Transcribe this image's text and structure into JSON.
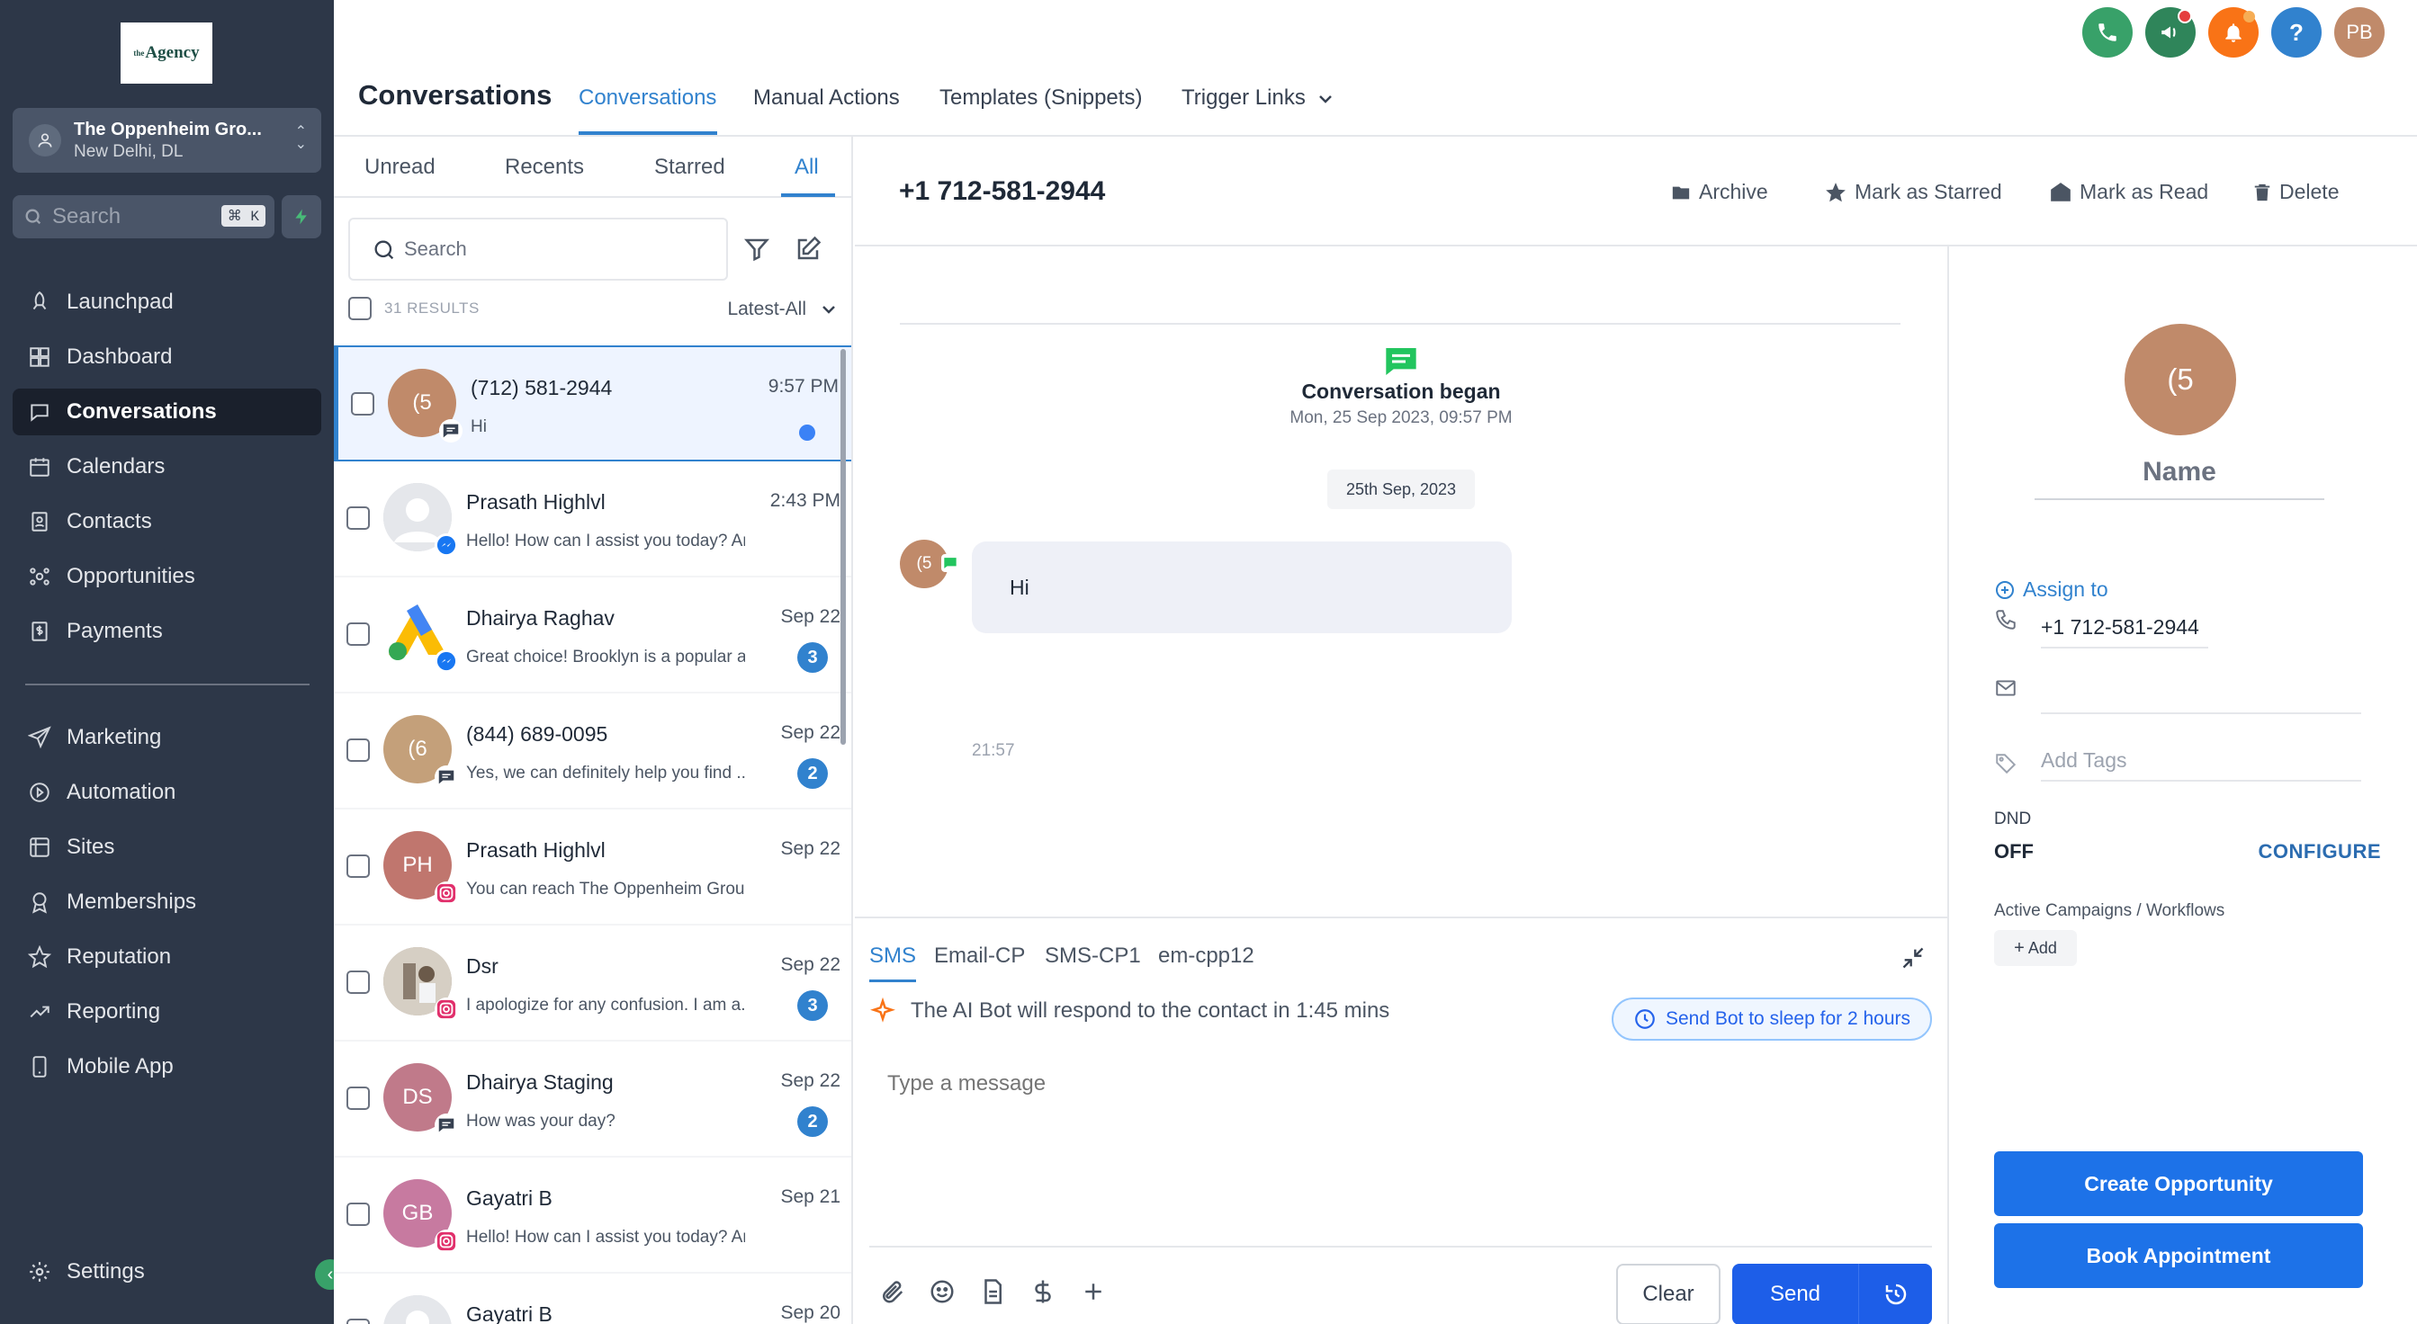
{
  "brand": {
    "logo_small": "the",
    "logo_text": "Agency"
  },
  "account": {
    "name": "The Oppenheim Gro...",
    "location": "New Delhi, DL"
  },
  "sidebar_search": {
    "placeholder": "Search",
    "shortcut": "⌘ K"
  },
  "nav": [
    {
      "label": "Launchpad",
      "icon": "rocket-icon"
    },
    {
      "label": "Dashboard",
      "icon": "dashboard-icon"
    },
    {
      "label": "Conversations",
      "icon": "chat-icon",
      "active": true
    },
    {
      "label": "Calendars",
      "icon": "calendar-icon"
    },
    {
      "label": "Contacts",
      "icon": "contacts-icon"
    },
    {
      "label": "Opportunities",
      "icon": "opportunities-icon"
    },
    {
      "label": "Payments",
      "icon": "payments-icon"
    }
  ],
  "nav2": [
    {
      "label": "Marketing",
      "icon": "send-icon"
    },
    {
      "label": "Automation",
      "icon": "automation-icon"
    },
    {
      "label": "Sites",
      "icon": "globe-icon"
    },
    {
      "label": "Memberships",
      "icon": "award-icon"
    },
    {
      "label": "Reputation",
      "icon": "star-icon"
    },
    {
      "label": "Reporting",
      "icon": "chart-icon"
    },
    {
      "label": "Mobile App",
      "icon": "mobile-icon"
    }
  ],
  "settings_label": "Settings",
  "header": {
    "title": "Conversations",
    "tabs": [
      "Conversations",
      "Manual Actions",
      "Templates (Snippets)",
      "Trigger Links"
    ],
    "user_initials": "PB",
    "help": "?"
  },
  "list": {
    "tabs": [
      "Unread",
      "Recents",
      "Starred",
      "All"
    ],
    "search_placeholder": "Search",
    "results": "31 RESULTS",
    "sort": "Latest-All",
    "items": [
      {
        "avatar": "(5",
        "name": "(712) 581-2944",
        "preview": "Hi",
        "time": "9:57 PM",
        "channel": "sms",
        "unread_dot": true,
        "color": "#c08a6a"
      },
      {
        "avatar": "",
        "name": "Prasath Highlvl",
        "preview": "Hello! How can I assist you today? Ar...",
        "time": "2:43 PM",
        "channel": "messenger",
        "color": "#d1d5db"
      },
      {
        "avatar": "",
        "name": "Dhairya Raghav",
        "preview": "Great choice! Brooklyn is a popular a...",
        "time": "Sep 22",
        "channel": "messenger",
        "count": "3",
        "color": "#ffffff"
      },
      {
        "avatar": "(6",
        "name": "(844) 689-0095",
        "preview": "Yes, we can definitely help you find ...",
        "time": "Sep 22",
        "channel": "sms",
        "count": "2",
        "color": "#c4a07a"
      },
      {
        "avatar": "PH",
        "name": "Prasath Highlvl",
        "preview": "You can reach The Oppenheim Group",
        "time": "Sep 22",
        "channel": "instagram",
        "color": "#c0766e"
      },
      {
        "avatar": "",
        "name": "Dsr",
        "preview": "I apologize for any confusion. I am a...",
        "time": "Sep 22",
        "channel": "instagram",
        "count": "3",
        "color": "#b9a89a"
      },
      {
        "avatar": "DS",
        "name": "Dhairya Staging",
        "preview": "How was your day?",
        "time": "Sep 22",
        "channel": "sms",
        "count": "2",
        "color": "#c07a8a"
      },
      {
        "avatar": "GB",
        "name": "Gayatri B",
        "preview": "Hello! How can I assist you today? Ar...",
        "time": "Sep 21",
        "channel": "instagram",
        "color": "#c77aa0"
      },
      {
        "avatar": "",
        "name": "Gayatri B",
        "preview": "",
        "time": "Sep 20",
        "channel": "",
        "color": "#d1d5db"
      }
    ]
  },
  "conversation": {
    "phone": "+1 712-581-2944",
    "actions": [
      "Archive",
      "Mark as Starred",
      "Mark as Read",
      "Delete"
    ],
    "began_title": "Conversation began",
    "began_date": "Mon, 25 Sep 2023, 09:57 PM",
    "date_chip": "25th Sep, 2023",
    "msg_avatar": "(5",
    "message": "Hi",
    "message_time": "21:57"
  },
  "composer": {
    "tabs": [
      "SMS",
      "Email-CP",
      "SMS-CP1",
      "em-cpp12"
    ],
    "ai_text": "The AI Bot will respond to the contact in 1:45 mins",
    "sleep_label": "Send Bot to sleep for 2 hours",
    "placeholder": "Type a message",
    "clear": "Clear",
    "send": "Send"
  },
  "contact": {
    "avatar": "(5",
    "name": "Name",
    "assign": "Assign to",
    "phone": "+1 712-581-2944",
    "email": "",
    "tags_placeholder": "Add Tags",
    "dnd_label": "DND",
    "dnd_value": "OFF",
    "configure": "CONFIGURE",
    "campaigns_label": "Active Campaigns / Workflows",
    "add": "Add",
    "create_opportunity": "Create Opportunity",
    "book_appointment": "Book Appointment"
  },
  "colors": {
    "accent": "#3182ce",
    "sidebar": "#2d3748",
    "primary_button": "#1d72e8"
  }
}
